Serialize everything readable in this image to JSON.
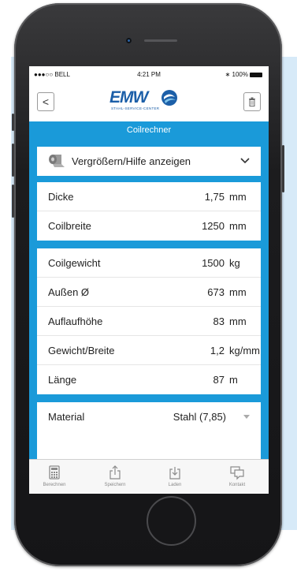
{
  "status_bar": {
    "carrier": "●●●○○ BELL",
    "time": "4:21 PM",
    "battery": "100%"
  },
  "header": {
    "logo_text": "EMW",
    "logo_subtitle": "STAHL-SERVICE-CENTER",
    "back_glyph": "<",
    "trash_glyph": "🗑"
  },
  "title": "Coilrechner",
  "toggle": {
    "label": "Vergrößern/Hilfe anzeigen",
    "chevron": "⌄"
  },
  "group1": [
    {
      "label": "Dicke",
      "value": "1,75",
      "unit": "mm"
    },
    {
      "label": "Coilbreite",
      "value": "1250",
      "unit": "mm"
    }
  ],
  "group2": [
    {
      "label": "Coilgewicht",
      "value": "1500",
      "unit": "kg"
    },
    {
      "label": "Außen Ø",
      "value": "673",
      "unit": "mm"
    },
    {
      "label": "Auflaufhöhe",
      "value": "83",
      "unit": "mm"
    },
    {
      "label": "Gewicht/Breite",
      "value": "1,2",
      "unit": "kg/mm"
    },
    {
      "label": "Länge",
      "value": "87",
      "unit": "m"
    }
  ],
  "material": {
    "label": "Material",
    "value": "Stahl (7,85)"
  },
  "tabs": [
    {
      "label": "Berechnen",
      "icon": "calculator-icon"
    },
    {
      "label": "Speichern",
      "icon": "share-icon"
    },
    {
      "label": "Laden",
      "icon": "download-icon"
    },
    {
      "label": "Kontakt",
      "icon": "chat-icon"
    }
  ],
  "colors": {
    "accent": "#1a9ad9",
    "brand": "#1c5fa8",
    "background_panel": "#d7eaf8"
  }
}
